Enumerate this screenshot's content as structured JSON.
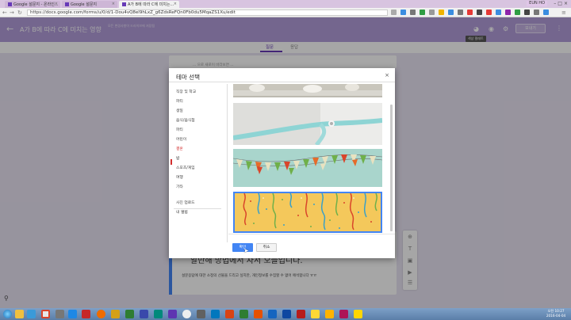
{
  "browser": {
    "tabs": [
      {
        "label": "Google 설문지 - 온라인...",
        "active": false
      },
      {
        "label": "Google 설문지",
        "active": false
      },
      {
        "label": "A가 B에 따라 C에 미치는...",
        "active": true
      }
    ],
    "user": "EUN HO",
    "url": "https://docs.google.com/forms/u/0/d/1-Dou4vQ8el9hLxZ_g6ZdsReFQn0Fb0du5MqaZS1Xu/edit"
  },
  "form": {
    "title": "A가 B에 따라 C에 미치는 영향",
    "subtitle": "모든 변경사항이 드라이브에 저장됨",
    "send_label": "보내기",
    "tooltip": "색상 팔레트",
    "tabs": {
      "questions": "질문",
      "responses": "응답"
    },
    "description_partial": "... 으로 새로이 바라보면 ...",
    "big_text": "알만해 방법에서 자서 오늘입니다.",
    "consent_text": "설문응답에 대한 소정의 선물을 드리고 싶지만, 개인정보를 수집할 수 없어 애석합니다 ㅠㅠ"
  },
  "dialog": {
    "title": "테마 선택",
    "close_icon": "close-icon",
    "categories": [
      {
        "label": "직장 및 학교",
        "selected": false
      },
      {
        "label": "파티",
        "selected": false
      },
      {
        "label": "생일",
        "selected": false
      },
      {
        "label": "음식/음식점",
        "selected": false
      },
      {
        "label": "파티",
        "selected": false
      },
      {
        "label": "어린이",
        "selected": false
      },
      {
        "label": "결혼",
        "selected": true
      },
      {
        "label": "밤",
        "selected": false
      },
      {
        "label": "스포츠/게임",
        "selected": false
      },
      {
        "label": "여행",
        "selected": false
      },
      {
        "label": "기타",
        "selected": false
      }
    ],
    "extra": [
      {
        "label": "사진 업로드"
      },
      {
        "label": "내 앨범"
      }
    ],
    "thumbnails": [
      {
        "name": "glasses-theme",
        "selected": false
      },
      {
        "name": "ribbon-theme",
        "selected": false
      },
      {
        "name": "bunting-theme",
        "selected": false
      },
      {
        "name": "confetti-theme",
        "selected": true
      }
    ],
    "ok_label": "확인",
    "cancel_label": "취소"
  },
  "taskbar": {
    "time": "오전 10:27",
    "date": "2016-04-04"
  },
  "colors": {
    "header": "#b39ddb",
    "accent": "#673ab7",
    "selected_category": "#d32f2f",
    "primary_button": "#4285f4"
  }
}
